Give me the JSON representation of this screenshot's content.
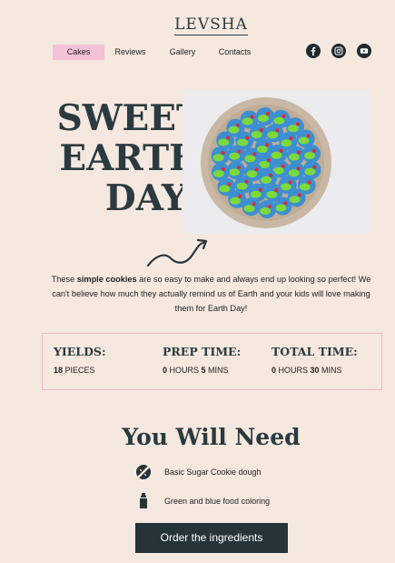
{
  "header": {
    "logo": "LEVSHA",
    "nav": [
      {
        "label": "Cakes",
        "active": true
      },
      {
        "label": "Reviews"
      },
      {
        "label": "Gallery"
      },
      {
        "label": "Contacts"
      }
    ],
    "social": [
      "facebook-icon",
      "instagram-icon",
      "youtube-icon"
    ]
  },
  "hero": {
    "title_lines": [
      "SWEET",
      "EARTH",
      "DAY!"
    ],
    "image": "earth-cookies-photo"
  },
  "intro": {
    "before": "These ",
    "bold": "simple cookies",
    "after": " are so easy to make and always end up looking so perfect! We can't believe how much they actually remind us of Earth and your kids will love making them for Earth Day!"
  },
  "stats": {
    "yields": {
      "label": "YIELDS:",
      "num": "18",
      "unit": " PIECES"
    },
    "prep": {
      "label": "PREP TIME:",
      "num1": "0",
      "unit1": " HOURS ",
      "num2": "5",
      "unit2": " MINS"
    },
    "total": {
      "label": "TOTAL TIME:",
      "num1": "0",
      "unit1": " HOURS ",
      "num2": "30",
      "unit2": " MINS"
    }
  },
  "need": {
    "title": "You Will Need",
    "items": [
      {
        "label": "Basic Sugar Cookie dough",
        "icon": "rolling-pin-icon"
      },
      {
        "label": "Green and blue food coloring",
        "icon": "bottle-icon"
      }
    ],
    "button": "Order the ingredients"
  },
  "colors": {
    "background": "#f5e8df",
    "accent_pink": "#f5c1d6",
    "dark": "#26343a"
  }
}
